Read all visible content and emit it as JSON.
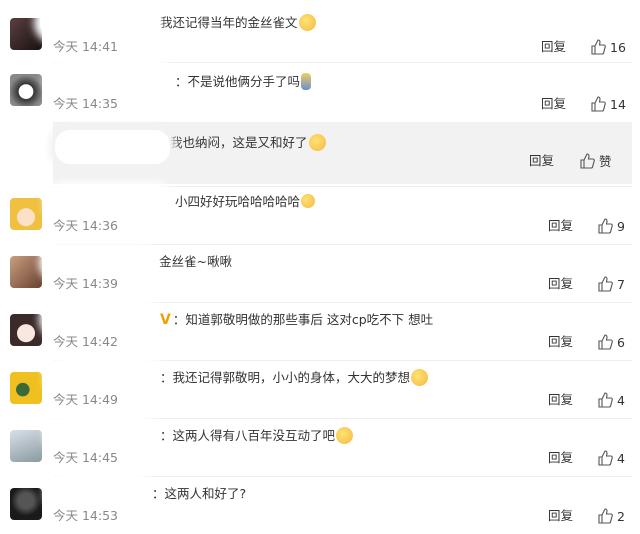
{
  "comments": [
    {
      "text": "我还记得当年的金丝雀文",
      "time": "今天 14:41",
      "reply": "回复",
      "likes": "16",
      "emoji": true,
      "avatar_color": "#3a2b2b"
    },
    {
      "text": "：不是说他俩分手了吗",
      "time": "今天 14:35",
      "reply": "回复",
      "likes": "14",
      "emoji": true,
      "avatar_color": "#6a6a6a"
    },
    {
      "text": "小四好好玩哈哈哈哈哈",
      "time": "今天 14:36",
      "reply": "回复",
      "likes": "9",
      "emoji": true,
      "avatar_color": "#e8c06a"
    },
    {
      "text": "金丝雀~啾啾",
      "time": "今天 14:39",
      "reply": "回复",
      "likes": "7",
      "emoji": false,
      "avatar_color": "#9a6a50"
    },
    {
      "text": "：知道郭敬明做的那些事后 这对cp吃不下 想吐",
      "time": "今天 14:42",
      "reply": "回复",
      "likes": "6",
      "emoji": false,
      "avatar_color": "#e8d0c0",
      "vbadge": "V"
    },
    {
      "text": "：我还记得郭敬明，小小的身体，大大的梦想",
      "time": "今天 14:49",
      "reply": "回复",
      "likes": "4",
      "emoji": true,
      "avatar_color": "#f0c020"
    },
    {
      "text": "：这两人得有八百年没互动了吧",
      "time": "今天 14:45",
      "reply": "回复",
      "likes": "4",
      "emoji": true,
      "avatar_color": "#b8c4c8"
    },
    {
      "text": "：这两人和好了?",
      "time": "今天 14:53",
      "reply": "回复",
      "likes": "2",
      "emoji": false,
      "avatar_color": "#2a2a2a"
    }
  ],
  "subreply": {
    "text": "我也纳闷，这是又和好了",
    "reply": "回复",
    "like_label": "赞",
    "emoji": true
  }
}
